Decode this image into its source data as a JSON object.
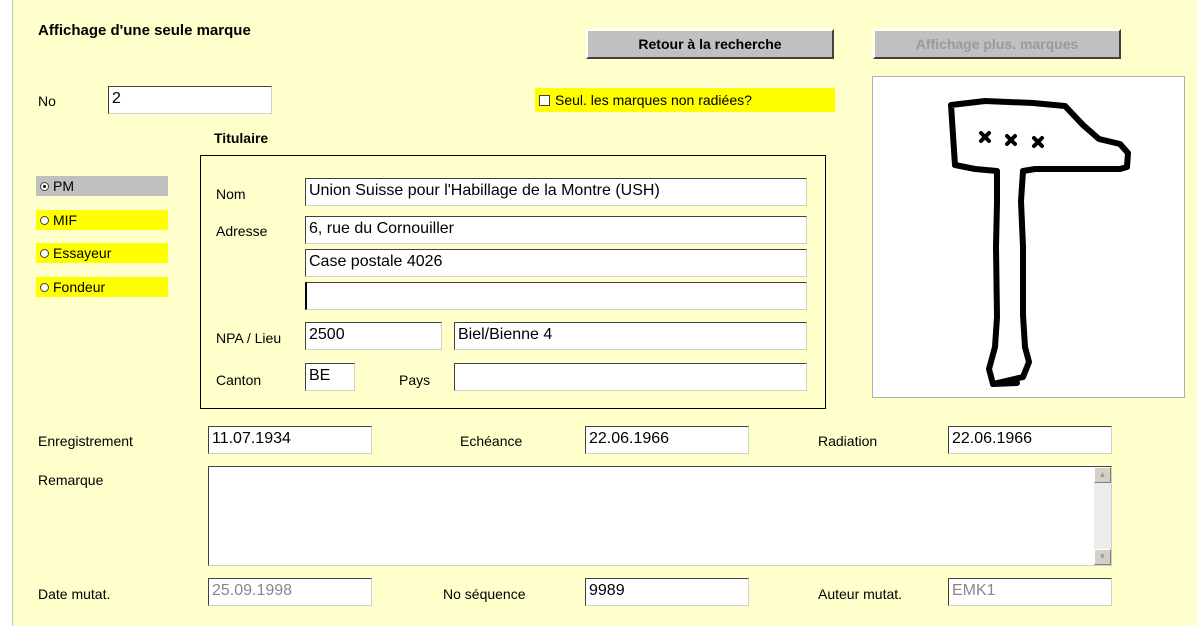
{
  "page": {
    "title": "Affichage d'une seule marque",
    "back_button": "Retour à la recherche",
    "multi_button": "Affichage plus. marques"
  },
  "no": {
    "label": "No",
    "value": "2"
  },
  "filter": {
    "label": "Seul. les marques non radiées?",
    "checked": false
  },
  "types": [
    {
      "label": "PM",
      "selected": true
    },
    {
      "label": "MIF",
      "selected": false
    },
    {
      "label": "Essayeur",
      "selected": false
    },
    {
      "label": "Fondeur",
      "selected": false
    }
  ],
  "titulaire": {
    "heading": "Titulaire",
    "nom_label": "Nom",
    "nom": "Union Suisse pour l'Habillage de la Montre (USH)",
    "adresse_label": "Adresse",
    "adresse1": "6, rue du Cornouiller",
    "adresse2": "Case postale 4026",
    "adresse3": "",
    "npa_label": "NPA / Lieu",
    "npa": "2500",
    "lieu": "Biel/Bienne 4",
    "canton_label": "Canton",
    "canton": "BE",
    "pays_label": "Pays",
    "pays": ""
  },
  "dates": {
    "enregistrement_label": "Enregistrement",
    "enregistrement": "11.07.1934",
    "echeance_label": "Echéance",
    "echeance": "22.06.1966",
    "radiation_label": "Radiation",
    "radiation": "22.06.1966"
  },
  "remarque": {
    "label": "Remarque",
    "value": ""
  },
  "footer": {
    "date_mutat_label": "Date mutat.",
    "date_mutat": "25.09.1998",
    "no_sequence_label": "No séquence",
    "no_sequence": "9989",
    "auteur_label": "Auteur mutat.",
    "auteur": "EMK1"
  },
  "mark_image": {
    "icon": "hammer-mark-icon",
    "inscription": "xxx"
  },
  "colors": {
    "panel": "#ffffcc",
    "highlight": "#ffff00",
    "selected": "#c0c0c0"
  }
}
